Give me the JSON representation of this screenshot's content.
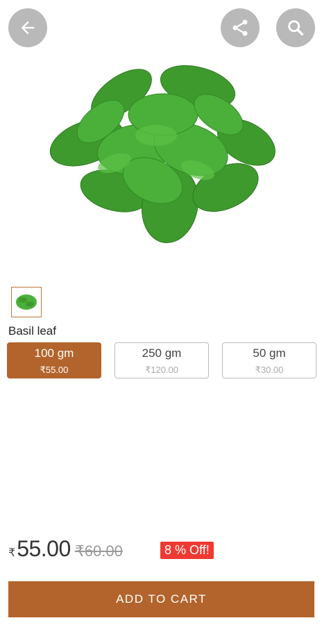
{
  "colors": {
    "accent": "#b2642c",
    "discount": "#ee3a33",
    "icon_button_bg": "#b9b9b9"
  },
  "icons": {
    "back": "arrow-left-icon",
    "share": "share-icon",
    "search": "search-icon"
  },
  "product": {
    "name": "Basil leaf",
    "currency_symbol": "₹",
    "price": "55.00",
    "mrp": "₹60.00",
    "discount_badge": "8 % Off!",
    "variants": [
      {
        "weight": "100 gm",
        "price": "₹55.00",
        "selected": true
      },
      {
        "weight": "250 gm",
        "price": "₹120.00",
        "selected": false
      },
      {
        "weight": "50 gm",
        "price": "₹30.00",
        "selected": false
      }
    ]
  },
  "actions": {
    "add_to_cart": "ADD TO CART"
  }
}
